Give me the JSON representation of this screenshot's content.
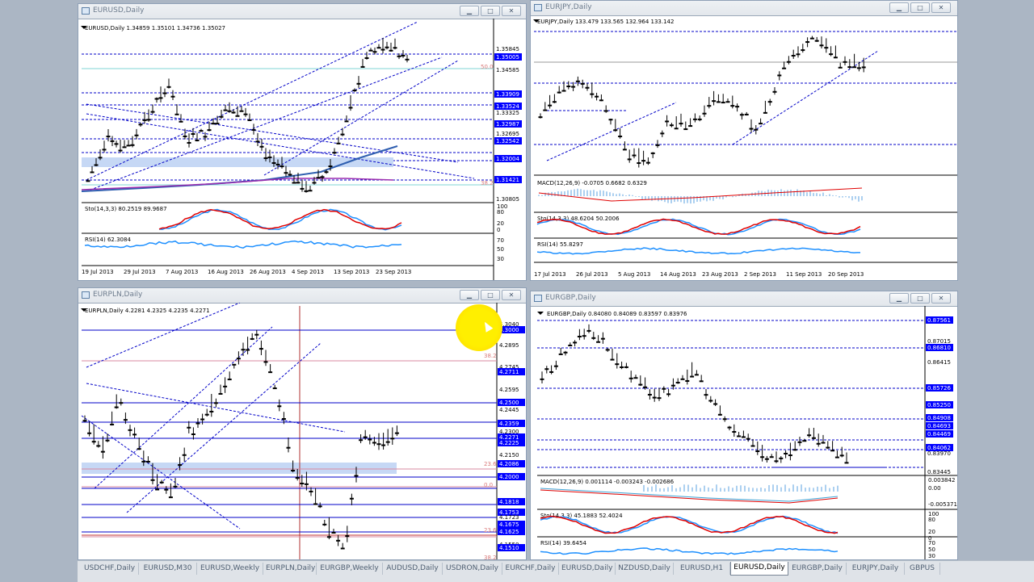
{
  "windows": [
    {
      "id": "eurusd",
      "title": "EURUSD,Daily",
      "state": "inactive",
      "header": "EURUSD,Daily  1.34859 1.35101 1.34736 1.35027",
      "price_labels": [
        "1.35845",
        "1.35005",
        "1.34585",
        "1.33909",
        "1.33524",
        "1.33325",
        "1.32987",
        "1.32695",
        "1.32542",
        "1.32004",
        "1.31421",
        "1.30805"
      ],
      "price_label_highlight": [
        false,
        true,
        false,
        true,
        true,
        false,
        true,
        false,
        true,
        true,
        true,
        false
      ],
      "fib_labels": [
        "50.0",
        "38.2"
      ],
      "stoch": "Sto(14,3,3) 80.2519 89.9687",
      "stoch_scale": [
        "100",
        "80",
        "20",
        "0"
      ],
      "rsi": "RSI(14) 62.3084",
      "rsi_scale": [
        "70",
        "50",
        "30"
      ],
      "dates": [
        "19 Jul 2013",
        "29 Jul 2013",
        "7 Aug 2013",
        "16 Aug 2013",
        "26 Aug 2013",
        "4 Sep 2013",
        "13 Sep 2013",
        "23 Sep 2013"
      ]
    },
    {
      "id": "eurjpy",
      "title": "EURJPY,Daily",
      "state": "inactive",
      "header": "EURJPY,Daily  133.479 133.565 132.964 133.142",
      "macd": "MACD(12,26,9) -0.0705 0.6682 0.6329",
      "stoch": "Sto(14,3,3) 48.6204 50.2006",
      "rsi": "RSI(14) 55.8297",
      "dates": [
        "17 Jul 2013",
        "26 Jul 2013",
        "5 Aug 2013",
        "14 Aug 2013",
        "23 Aug 2013",
        "2 Sep 2013",
        "11 Sep 2013",
        "20 Sep 2013"
      ]
    },
    {
      "id": "eurpln",
      "title": "EURPLN,Daily",
      "state": "inactive",
      "header": "EURPLN,Daily  4.2281 4.2325 4.2235 4.2271",
      "price_labels": [
        "4.3040",
        "4.3000",
        "4.2895",
        "4.2745",
        "4.2711",
        "4.2595",
        "4.2500",
        "4.2445",
        "4.2359",
        "4.2300",
        "4.2271",
        "4.2225",
        "4.2150",
        "4.2086",
        "4.2000",
        "4.1818",
        "4.1753",
        "4.1723",
        "4.1675",
        "4.1625",
        "4.1550",
        "4.1510"
      ],
      "price_label_highlight": [
        false,
        true,
        false,
        false,
        true,
        false,
        true,
        false,
        true,
        false,
        true,
        true,
        false,
        true,
        true,
        true,
        true,
        false,
        true,
        true,
        false,
        true
      ],
      "fib_labels": [
        "38.2",
        "23.6",
        "0.0",
        "23.6",
        "38.2"
      ]
    },
    {
      "id": "eurgbp",
      "title": "EURGBP,Daily",
      "state": "inactive",
      "header": "EURGBP,Daily  0.84080 0.84089 0.83597 0.83976",
      "price_labels": [
        "0.87561",
        "0.87015",
        "0.86810",
        "0.86415",
        "0.85726",
        "0.85250",
        "0.84908",
        "0.84693",
        "0.84469",
        "0.84062",
        "0.83970",
        "0.83445"
      ],
      "price_label_highlight": [
        true,
        false,
        true,
        false,
        true,
        true,
        true,
        true,
        true,
        true,
        false,
        false
      ],
      "macd": "MACD(12,26,9) 0.001114 -0.003243 -0.002686",
      "macd_scale": [
        "0.003842",
        "0.00",
        "-0.005371"
      ],
      "stoch": "Sto(14,3,3) 45.1883 52.4024",
      "stoch_scale": [
        "100",
        "80",
        "20",
        "0"
      ],
      "rsi": "RSI(14) 39.6454",
      "rsi_scale": [
        "70",
        "50",
        "30"
      ]
    }
  ],
  "window_buttons": {
    "minimize": "▁",
    "maximize": "□",
    "close": "✕"
  },
  "tabs": [
    "USDCHF,Daily",
    "EURUSD,M30",
    "EURUSD,Weekly",
    "EURPLN,Daily",
    "EURGBP,Weekly",
    "AUDUSD,Daily",
    "USDRON,Daily",
    "EURCHF,Daily",
    "EURUSD,Daily",
    "NZDUSD,Daily",
    "EURUSD,H1",
    "EURUSD,Daily",
    "EURGBP,Daily",
    "EURJPY,Daily",
    "GBPUS"
  ],
  "active_tab": 11,
  "colors": {
    "bull": "#ffffff",
    "bear": "#000000",
    "level_blue": "#0000c8",
    "label_bg": "#0000ff",
    "stoch_main": "#1e90ff",
    "stoch_signal": "#e00000",
    "rsi": "#1e90ff",
    "ma_blue": "#2f5fb0",
    "ma_purple": "#9a2db0",
    "zone": "#c6d8f5",
    "cursor": "#ffe800"
  }
}
